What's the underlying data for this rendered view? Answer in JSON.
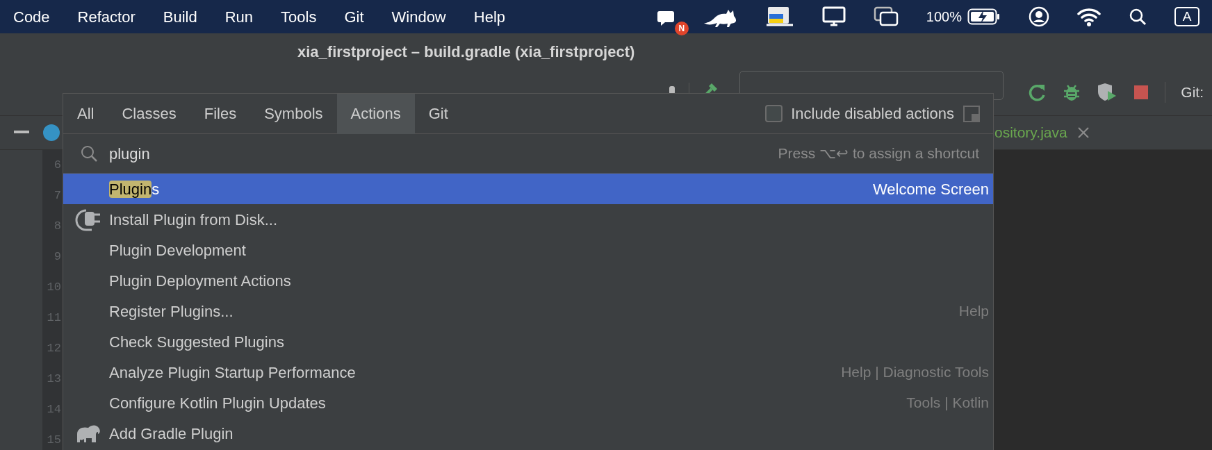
{
  "menu_bar": {
    "items": [
      "Code",
      "Refactor",
      "Build",
      "Run",
      "Tools",
      "Git",
      "Window",
      "Help"
    ],
    "notification_badge": "N",
    "battery": "100%",
    "input_source": "A"
  },
  "window": {
    "title": "xia_firstproject – build.gradle (xia_firstproject)"
  },
  "toolbar": {
    "git_label": "Git:"
  },
  "editor": {
    "tab": {
      "label": "ository.java"
    },
    "line_numbers": [
      "6",
      "7",
      "8",
      "9",
      "10",
      "11",
      "12",
      "13",
      "14",
      "15"
    ]
  },
  "search_popup": {
    "tabs": [
      {
        "label": "All",
        "selected": false
      },
      {
        "label": "Classes",
        "selected": false
      },
      {
        "label": "Files",
        "selected": false
      },
      {
        "label": "Symbols",
        "selected": false
      },
      {
        "label": "Actions",
        "selected": true
      },
      {
        "label": "Git",
        "selected": false
      }
    ],
    "include_disabled": {
      "label": "Include disabled actions",
      "checked": false
    },
    "search": {
      "value": "plugin",
      "shortcut_hint": "Press ⌥↩ to assign a shortcut"
    },
    "results": [
      {
        "label_parts": [
          {
            "text": "Plugin",
            "highlighted": true
          },
          {
            "text": "s",
            "highlighted": false
          }
        ],
        "group": "Welcome Screen",
        "selected": true
      },
      {
        "label_parts": [
          {
            "text": "Install Plugin from Disk...",
            "highlighted": false
          }
        ],
        "kind": "plug",
        "selected": false
      },
      {
        "label_parts": [
          {
            "text": "Plugin Development",
            "highlighted": false
          }
        ],
        "selected": false
      },
      {
        "label_parts": [
          {
            "text": "Plugin Deployment Actions",
            "highlighted": false
          }
        ],
        "selected": false
      },
      {
        "label_parts": [
          {
            "text": "Register Plugins...",
            "highlighted": false
          }
        ],
        "group": "Help",
        "selected": false
      },
      {
        "label_parts": [
          {
            "text": "Check Suggested Plugins",
            "highlighted": false
          }
        ],
        "selected": false
      },
      {
        "label_parts": [
          {
            "text": "Analyze Plugin Startup Performance",
            "highlighted": false
          }
        ],
        "group": "Help | Diagnostic Tools",
        "selected": false
      },
      {
        "label_parts": [
          {
            "text": "Configure Kotlin Plugin Updates",
            "highlighted": false
          }
        ],
        "group": "Tools | Kotlin",
        "selected": false
      },
      {
        "label_parts": [
          {
            "text": "Add Gradle Plugin",
            "highlighted": false
          }
        ],
        "kind": "elephant",
        "selected": false
      }
    ]
  }
}
